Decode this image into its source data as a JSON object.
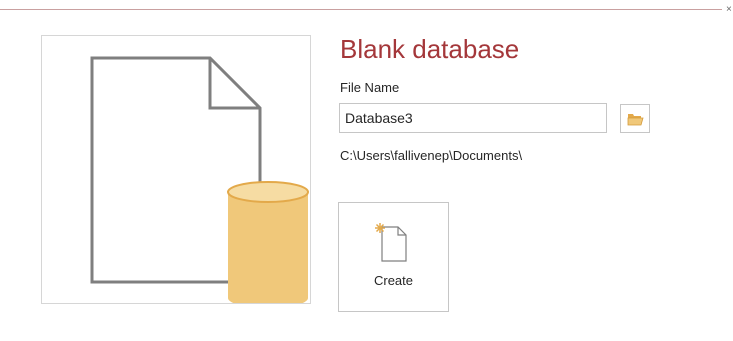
{
  "template": {
    "title": "Blank database",
    "file_name_label": "File Name",
    "file_name_value": "Database3",
    "save_location": "C:\\Users\\fallivenep\\Documents\\",
    "create_label": "Create"
  },
  "icons": {
    "preview": "database-file-icon",
    "browse": "folder-open-icon",
    "create": "new-document-icon"
  },
  "colors": {
    "title": "#a4373a",
    "database_fill": "#f0c87a",
    "database_stroke": "#e3a94a",
    "document_outline": "#7f7f7f"
  }
}
